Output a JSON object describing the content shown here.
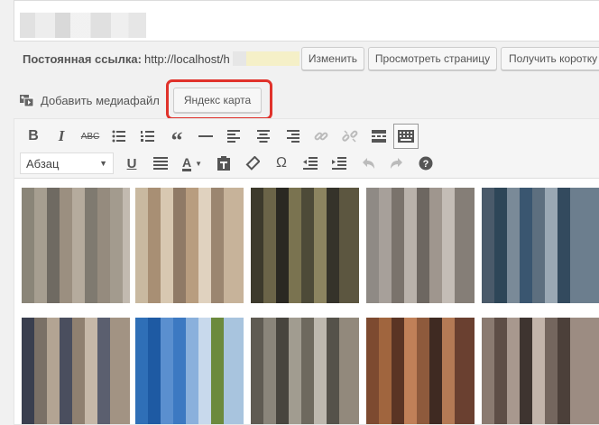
{
  "permalink": {
    "label": "Постоянная ссылка:",
    "url_prefix": "http://localhost/",
    "url_visible_suffix": "h"
  },
  "buttons": {
    "change": "Изменить",
    "view_page": "Просмотреть страницу",
    "get_shortlink": "Получить коротку"
  },
  "media": {
    "add_media": "Добавить медиафайл",
    "yandex_map": "Яндекс карта"
  },
  "toolbar": {
    "row1": [
      "bold-icon",
      "italic-icon",
      "strikethrough-icon",
      "bullet-list-icon",
      "numbered-list-icon",
      "blockquote-icon",
      "horizontal-line-icon",
      "align-left-icon",
      "align-center-icon",
      "align-right-icon",
      "link-icon",
      "unlink-icon",
      "read-more-icon",
      "toolbar-toggle-icon"
    ],
    "format_select": "Абзац",
    "row2": [
      "underline-icon",
      "justify-icon",
      "text-color-icon",
      "paste-text-icon",
      "clear-formatting-icon",
      "special-character-icon",
      "outdent-icon",
      "indent-icon",
      "undo-icon",
      "redo-icon",
      "help-icon"
    ]
  },
  "colors": {
    "highlight": "#e0322b"
  }
}
